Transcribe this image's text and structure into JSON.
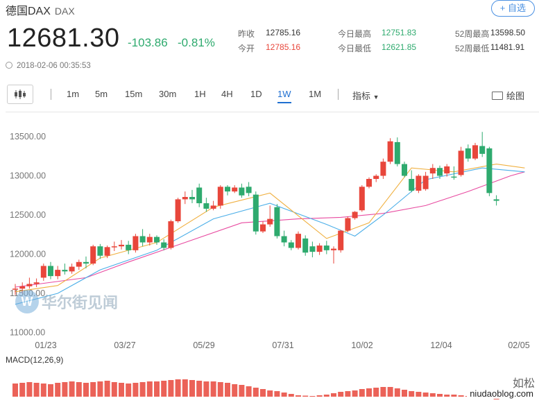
{
  "header": {
    "name": "德国DAX",
    "code": "DAX",
    "follow_label": "+ 自选",
    "price": "12681.30",
    "change": "-103.86",
    "change_pct": "-0.81%",
    "timestamp": "2018-02-06 00:35:53"
  },
  "stats": [
    {
      "label": "昨收",
      "value": "12785.16",
      "color": "#333333"
    },
    {
      "label": "今开",
      "value": "12785.16",
      "color": "#e8463b"
    },
    {
      "label": "今日最高",
      "value": "12751.83",
      "color": "#2eaa6e"
    },
    {
      "label": "今日最低",
      "value": "12621.85",
      "color": "#2eaa6e"
    },
    {
      "label": "52周最高",
      "value": "13598.50",
      "color": "#333333"
    },
    {
      "label": "52周最低",
      "value": "11481.91",
      "color": "#333333"
    }
  ],
  "toolbar": {
    "periods": [
      "1m",
      "5m",
      "15m",
      "30m",
      "1H",
      "4H",
      "1D",
      "1W",
      "1M"
    ],
    "active_period": "1W",
    "indicators_label": "指标",
    "draw_label": "绘图"
  },
  "colors": {
    "up": "#e8463b",
    "down": "#2eaa6e",
    "ma_short": "#f0b040",
    "ma_mid": "#4aaee8",
    "ma_long": "#e84aa0",
    "accent": "#1f6fd1"
  },
  "chart_data": {
    "type": "candlestick",
    "y_ticks": [
      "13500.00",
      "13000.00",
      "12500.00",
      "12000.00",
      "11500.00",
      "11000.00"
    ],
    "x_ticks": [
      "01/23",
      "03/27",
      "05/29",
      "07/31",
      "10/02",
      "12/04",
      "02/05"
    ],
    "candles": [
      [
        11550,
        11560,
        11480,
        11620
      ],
      [
        11560,
        11590,
        11500,
        11640
      ],
      [
        11590,
        11620,
        11560,
        11700
      ],
      [
        11620,
        11640,
        11580,
        11690
      ],
      [
        11700,
        11850,
        11660,
        11880
      ],
      [
        11850,
        11720,
        11680,
        11900
      ],
      [
        11720,
        11800,
        11680,
        11850
      ],
      [
        11800,
        11780,
        11740,
        11880
      ],
      [
        11780,
        11840,
        11750,
        11880
      ],
      [
        11840,
        11900,
        11800,
        11930
      ],
      [
        11900,
        11880,
        11820,
        11970
      ],
      [
        11880,
        12100,
        11860,
        12120
      ],
      [
        12100,
        11980,
        11940,
        12130
      ],
      [
        11980,
        12090,
        11950,
        12110
      ],
      [
        12090,
        12100,
        12040,
        12160
      ],
      [
        12100,
        12120,
        12060,
        12180
      ],
      [
        12120,
        12050,
        12000,
        12170
      ],
      [
        12050,
        12230,
        12020,
        12260
      ],
      [
        12230,
        12150,
        12100,
        12320
      ],
      [
        12150,
        12220,
        12110,
        12260
      ],
      [
        12220,
        12150,
        12120,
        12240
      ],
      [
        12150,
        12080,
        12050,
        12190
      ],
      [
        12080,
        12420,
        12060,
        12440
      ],
      [
        12420,
        12700,
        12400,
        12720
      ],
      [
        12700,
        12730,
        12640,
        12800
      ],
      [
        12730,
        12700,
        12650,
        12820
      ],
      [
        12850,
        12650,
        12600,
        12900
      ],
      [
        12650,
        12580,
        12540,
        12720
      ],
      [
        12580,
        12620,
        12560,
        12680
      ],
      [
        12620,
        12860,
        12580,
        12880
      ],
      [
        12860,
        12800,
        12750,
        12880
      ],
      [
        12800,
        12850,
        12780,
        12880
      ],
      [
        12850,
        12750,
        12720,
        12900
      ],
      [
        12860,
        12780,
        12740,
        12920
      ],
      [
        12760,
        12290,
        12250,
        12800
      ],
      [
        12290,
        12380,
        12270,
        12420
      ],
      [
        12380,
        12450,
        12350,
        12620
      ],
      [
        12600,
        12230,
        12200,
        12640
      ],
      [
        12230,
        12150,
        12100,
        12300
      ],
      [
        12150,
        12080,
        12050,
        12180
      ],
      [
        12080,
        12260,
        12060,
        12290
      ],
      [
        12200,
        12020,
        11980,
        12240
      ],
      [
        12100,
        12030,
        11960,
        12160
      ],
      [
        12030,
        12110,
        11990,
        12140
      ],
      [
        12110,
        12050,
        12000,
        12170
      ],
      [
        12050,
        12070,
        11880,
        12100
      ],
      [
        12050,
        12300,
        12020,
        12310
      ],
      [
        12300,
        12460,
        12280,
        12480
      ],
      [
        12460,
        12540,
        12440,
        12550
      ],
      [
        12560,
        12860,
        12540,
        12880
      ],
      [
        12860,
        12960,
        12840,
        12980
      ],
      [
        12960,
        13000,
        12920,
        13020
      ],
      [
        13000,
        13180,
        12960,
        13220
      ],
      [
        13180,
        13440,
        13150,
        13480
      ],
      [
        13430,
        13150,
        13120,
        13490
      ],
      [
        13150,
        13000,
        12980,
        13180
      ],
      [
        12960,
        12810,
        12790,
        13070
      ],
      [
        12810,
        13000,
        12780,
        13020
      ],
      [
        12830,
        13000,
        12810,
        13050
      ],
      [
        13030,
        13100,
        12960,
        13150
      ],
      [
        13100,
        13000,
        12960,
        13130
      ],
      [
        13030,
        13120,
        12990,
        13150
      ],
      [
        12990,
        12980,
        12950,
        13120
      ],
      [
        13010,
        13320,
        12990,
        13370
      ],
      [
        13350,
        13220,
        13180,
        13400
      ],
      [
        13220,
        13390,
        13200,
        13420
      ],
      [
        13380,
        13280,
        13240,
        13560
      ],
      [
        13350,
        12780,
        12740,
        13370
      ],
      [
        12700,
        12681,
        12621,
        12752
      ]
    ],
    "ma_short": [
      [
        0,
        11520
      ],
      [
        6,
        11600
      ],
      [
        12,
        11950
      ],
      [
        20,
        12150
      ],
      [
        28,
        12600
      ],
      [
        36,
        12780
      ],
      [
        44,
        12200
      ],
      [
        50,
        12400
      ],
      [
        56,
        13100
      ],
      [
        62,
        13050
      ],
      [
        68,
        13150
      ],
      [
        72,
        13100
      ]
    ],
    "ma_mid": [
      [
        0,
        11360
      ],
      [
        6,
        11500
      ],
      [
        12,
        11800
      ],
      [
        20,
        12050
      ],
      [
        28,
        12450
      ],
      [
        36,
        12650
      ],
      [
        44,
        12380
      ],
      [
        48,
        12230
      ],
      [
        52,
        12500
      ],
      [
        58,
        12950
      ],
      [
        66,
        13100
      ],
      [
        72,
        13050
      ]
    ],
    "ma_long": [
      [
        0,
        11580
      ],
      [
        10,
        11700
      ],
      [
        16,
        11900
      ],
      [
        24,
        12150
      ],
      [
        32,
        12400
      ],
      [
        40,
        12450
      ],
      [
        46,
        12470
      ],
      [
        52,
        12520
      ],
      [
        58,
        12620
      ],
      [
        64,
        12800
      ],
      [
        70,
        13000
      ],
      [
        72,
        13050
      ]
    ],
    "macd_label": "MACD(12,26,9)",
    "macd_hist": [
      38,
      40,
      42,
      40,
      38,
      36,
      40,
      42,
      44,
      42,
      40,
      42,
      44,
      46,
      42,
      40,
      38,
      40,
      42,
      44,
      44,
      46,
      48,
      50,
      50,
      48,
      46,
      44,
      44,
      42,
      40,
      36,
      34,
      30,
      26,
      22,
      18,
      16,
      12,
      8,
      4,
      3,
      2,
      4,
      6,
      10,
      14,
      16,
      18,
      22,
      24,
      26,
      28,
      28,
      24,
      20,
      16,
      14,
      12,
      10,
      8,
      6,
      6,
      4,
      2,
      -2,
      -4,
      -6,
      -8
    ]
  },
  "watermark": {
    "logo": "W",
    "text": "华尔街见闻",
    "bottom_text": "如松",
    "blog": "niudaoblog.com"
  }
}
